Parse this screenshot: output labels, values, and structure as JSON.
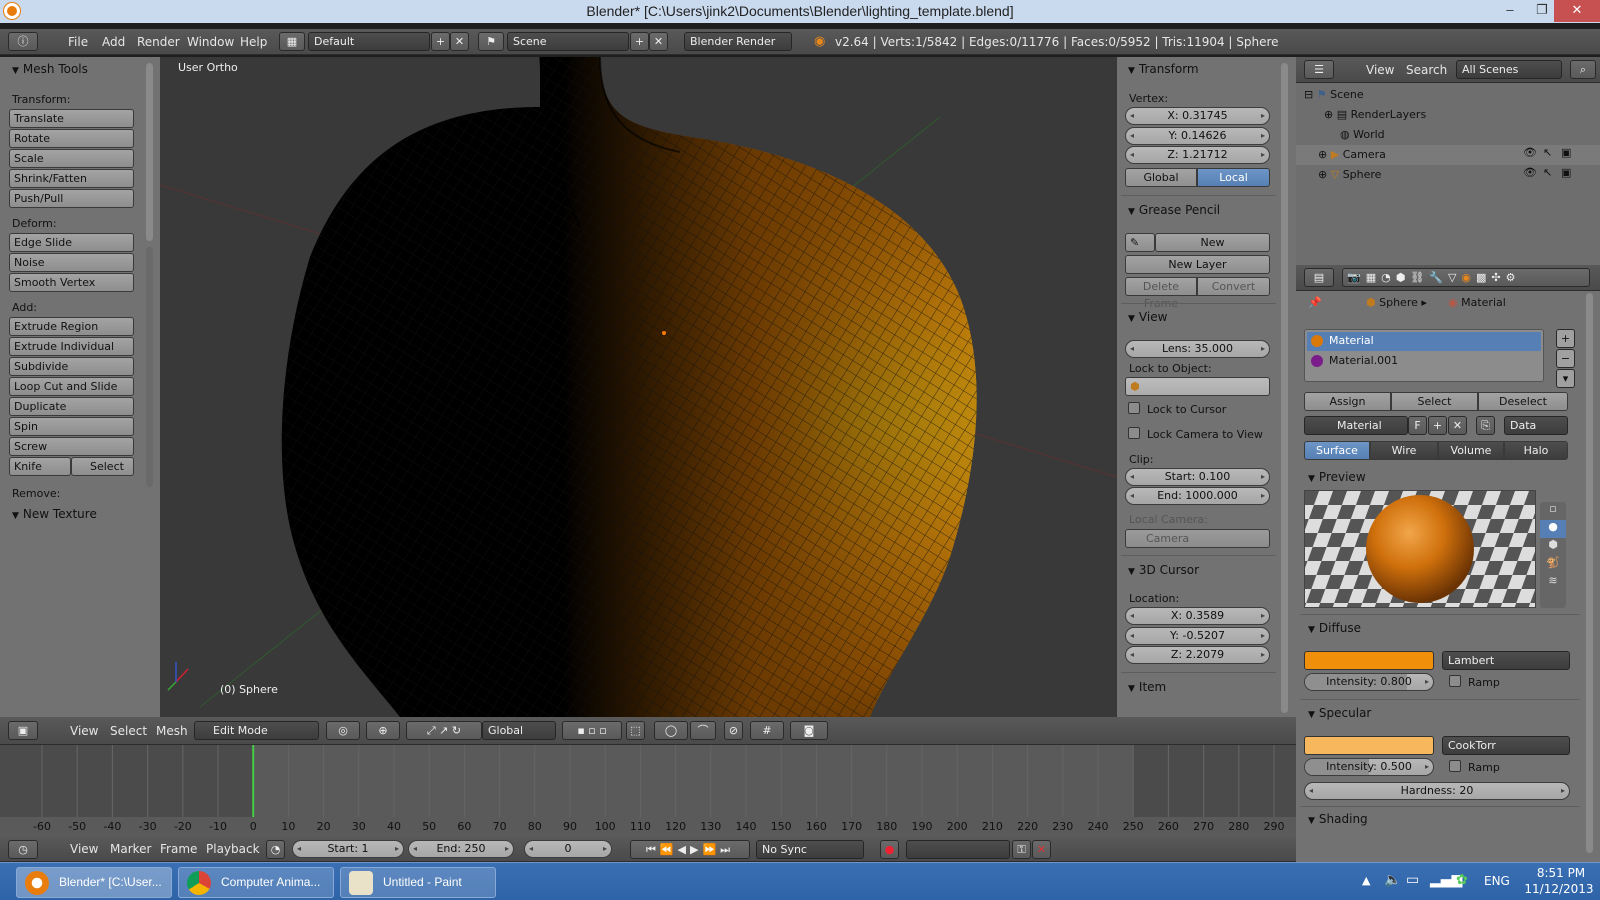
{
  "window": {
    "title": "Blender* [C:\\Users\\jink2\\Documents\\Blender\\lighting_template.blend]",
    "minimize": "–",
    "maximize": "❐",
    "close": "✕"
  },
  "info_header": {
    "menus": [
      "File",
      "Add",
      "Render",
      "Window",
      "Help"
    ],
    "layout": "Default",
    "scene": "Scene",
    "engine": "Blender Render",
    "stats": "v2.64 | Verts:1/5842 | Edges:0/11776 | Faces:0/5952 | Tris:11904 | Sphere"
  },
  "mesh_tools": {
    "title": "Mesh Tools",
    "transform_label": "Transform:",
    "transform": [
      "Translate",
      "Rotate",
      "Scale",
      "Shrink/Fatten",
      "Push/Pull"
    ],
    "deform_label": "Deform:",
    "deform": [
      "Edge Slide",
      "Noise",
      "Smooth Vertex"
    ],
    "add_label": "Add:",
    "add": [
      "Extrude Region",
      "Extrude Individual",
      "Subdivide",
      "Loop Cut and Slide",
      "Duplicate",
      "Spin",
      "Screw"
    ],
    "knife": "Knife",
    "select": "Select",
    "remove_label": "Remove:",
    "new_texture": "New Texture"
  },
  "viewport": {
    "view_name": "User Ortho",
    "object_name": "(0) Sphere"
  },
  "properties_n": {
    "transform": {
      "title": "Transform",
      "vertex_label": "Vertex:",
      "x": "X: 0.31745",
      "y": "Y: 0.14626",
      "z": "Z: 1.21712",
      "global": "Global",
      "local": "Local"
    },
    "grease": {
      "title": "Grease Pencil",
      "new": "New",
      "new_layer": "New Layer",
      "delete_frame": "Delete Frame",
      "convert": "Convert"
    },
    "view": {
      "title": "View",
      "lens": "Lens: 35.000",
      "lock_to_object": "Lock to Object:",
      "lock_to_cursor": "Lock to Cursor",
      "lock_camera": "Lock Camera to View",
      "clip": "Clip:",
      "clip_start": "Start: 0.100",
      "clip_end": "End: 1000.000",
      "local_camera": "Local Camera:",
      "camera": "Camera"
    },
    "cursor": {
      "title": "3D Cursor",
      "location": "Location:",
      "x": "X: 0.3589",
      "y": "Y: -0.5207",
      "z": "Z: 2.2079"
    },
    "item": {
      "title": "Item"
    }
  },
  "view3d_header": {
    "menus": [
      "View",
      "Select",
      "Mesh"
    ],
    "mode": "Edit Mode",
    "orientation": "Global"
  },
  "timeline": {
    "ticks": [
      "-60",
      "-50",
      "-40",
      "-30",
      "-20",
      "-10",
      "0",
      "10",
      "20",
      "30",
      "40",
      "50",
      "60",
      "70",
      "80",
      "90",
      "100",
      "110",
      "120",
      "130",
      "140",
      "150",
      "160",
      "170",
      "180",
      "190",
      "200",
      "210",
      "220",
      "230",
      "240",
      "250",
      "260",
      "270",
      "280",
      "290"
    ],
    "current_frame": 0,
    "menus": [
      "View",
      "Marker",
      "Frame",
      "Playback"
    ],
    "start": "Start: 1",
    "end": "End: 250",
    "frame": "0",
    "sync": "No Sync"
  },
  "outliner": {
    "view": "View",
    "search": "Search",
    "filter": "All Scenes",
    "items": [
      "Scene",
      "RenderLayers",
      "World",
      "Camera",
      "Sphere"
    ]
  },
  "properties": {
    "breadcrumb_object": "Sphere",
    "breadcrumb_material": "Material",
    "slots": [
      "Material",
      "Material.001"
    ],
    "assign": "Assign",
    "select": "Select",
    "deselect": "Deselect",
    "material_name": "Material",
    "fake_user": "F",
    "link": "Data",
    "tabs": [
      "Surface",
      "Wire",
      "Volume",
      "Halo"
    ],
    "preview_title": "Preview",
    "diffuse_title": "Diffuse",
    "diffuse_shader": "Lambert",
    "diffuse_intensity": "Intensity: 0.800",
    "diffuse_intensity_value": 0.8,
    "ramp": "Ramp",
    "specular_title": "Specular",
    "specular_shader": "CookTorr",
    "specular_intensity": "Intensity: 0.500",
    "specular_intensity_value": 0.5,
    "hardness": "Hardness: 20",
    "shading_title": "Shading",
    "diffuse_color": "#f0900a",
    "specular_color": "#f7b75c"
  },
  "taskbar": {
    "tasks": [
      "Blender* [C:\\User...",
      "Computer Anima...",
      "Untitled - Paint"
    ],
    "lang": "ENG",
    "time": "8:51 PM",
    "date": "11/12/2013"
  },
  "colors": {
    "accent": "#5680b5",
    "mesh_orange": "#f0a010"
  }
}
